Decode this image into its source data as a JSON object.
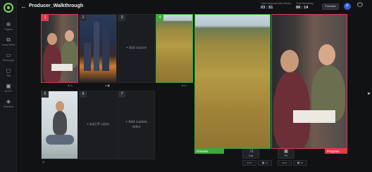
{
  "app": {
    "title": "Producer_Walkthrough",
    "back_icon": "arrow-left-icon"
  },
  "sidebar": {
    "items": [
      {
        "label": "Outputs",
        "icon": "plus-circle-icon"
      },
      {
        "label": "Scene Mixer",
        "icon": "mixer-icon"
      },
      {
        "label": "Resources",
        "icon": "folder-icon"
      },
      {
        "label": "Talk",
        "icon": "chat-icon"
      },
      {
        "label": "DC/VC",
        "icon": "monitor-icon"
      },
      {
        "label": "Branding",
        "icon": "layers-icon"
      }
    ]
  },
  "header": {
    "consumed_label": "Total Consumed (this Month)",
    "consumed_value": "03 : 51",
    "remaining_label": "Time Remaining",
    "remaining_value": "88 : 14",
    "purchase_label": "Purchase",
    "avatar_initial": "P"
  },
  "sources": [
    {
      "num": "1",
      "state": "active-program"
    },
    {
      "num": "2",
      "state": "loaded"
    },
    {
      "num": "3",
      "state": "empty",
      "placeholder": "+ Add source"
    },
    {
      "num": "4",
      "state": "active-preview"
    },
    {
      "num": "5",
      "state": "loaded"
    },
    {
      "num": "6",
      "state": "empty",
      "placeholder": "+ Add IP video"
    },
    {
      "num": "7",
      "state": "empty",
      "placeholder": "+ Add custom video"
    }
  ],
  "monitors": {
    "preview_label": "Preview",
    "program_label": "Program"
  },
  "transitions": {
    "cut_label": "Cut",
    "fade_label": "Fx",
    "cut_icon": "swap-icon",
    "fade_icon": "fade-icon"
  },
  "colors": {
    "program": "#e0394d",
    "preview": "#3ea83a",
    "accent": "#7ed957"
  }
}
